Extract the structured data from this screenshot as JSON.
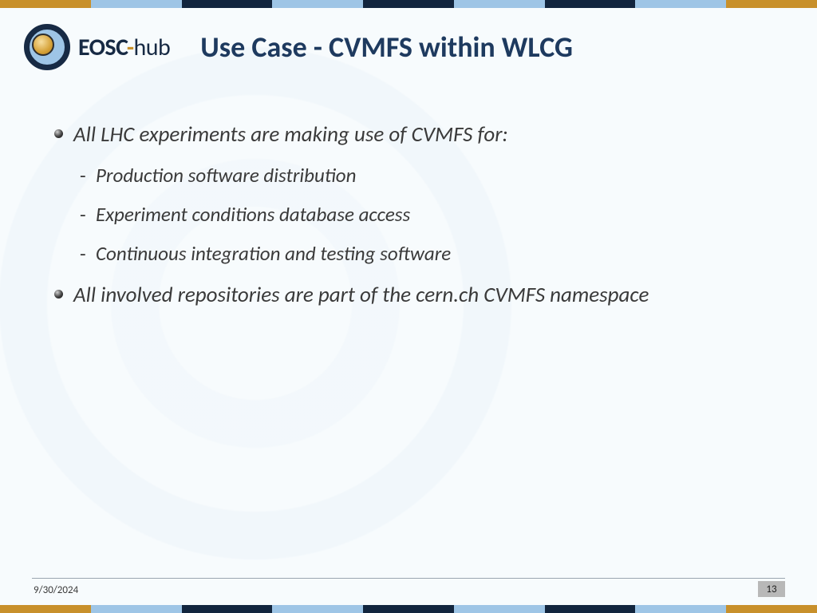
{
  "logo": {
    "text_main": "EOSC",
    "text_dash": "-",
    "text_hub": "hub"
  },
  "title": "Use Case - CVMFS within WLCG",
  "bullets": [
    {
      "text": "All LHC experiments are making use of CVMFS for:",
      "children": [
        "Production software distribution",
        "Experiment conditions database access",
        "Continuous integration and testing software"
      ]
    },
    {
      "text": "All involved repositories are part of the cern.ch CVMFS namespace",
      "children": []
    }
  ],
  "footer": {
    "date": "9/30/2024",
    "page": "13"
  },
  "colors": {
    "gold": "#c8902b",
    "navy": "#12253e",
    "lightblue": "#9ec5e6",
    "title": "#1e3a5f"
  }
}
